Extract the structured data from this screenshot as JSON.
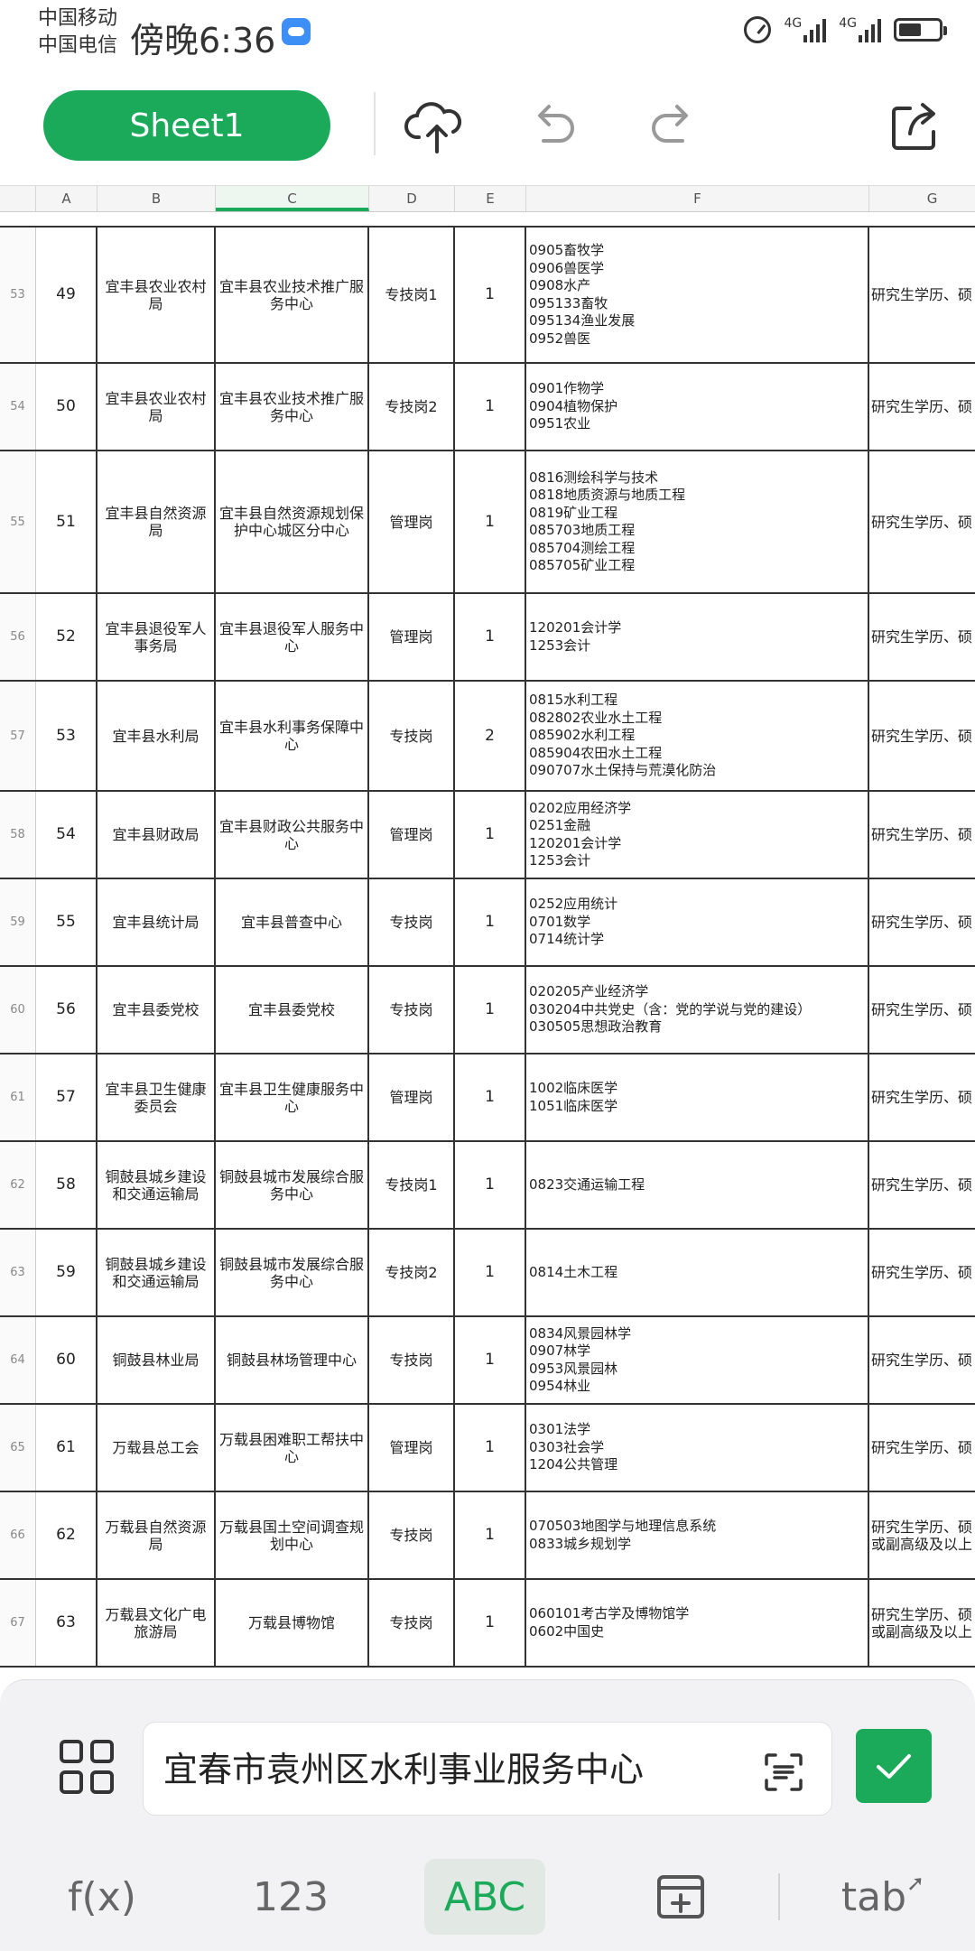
{
  "status": {
    "carrier1": "中国移动",
    "carrier2": "中国电信",
    "time": "傍晚6:36",
    "net1": "4G",
    "net2": "4G"
  },
  "toolbar": {
    "sheet_label": "Sheet1",
    "icons": [
      "cloud-upload-icon",
      "undo-icon",
      "redo-icon",
      "share-icon"
    ]
  },
  "columns": [
    "A",
    "B",
    "C",
    "D",
    "E",
    "F",
    "G"
  ],
  "rows": [
    {
      "rn": "53",
      "a": "49",
      "b": "宜丰县农业农村局",
      "c": "宜丰县农业技术推广服务中心",
      "d": "专技岗1",
      "e": "1",
      "f": "0905畜牧学\n0906兽医学\n0908水产\n095133畜牧\n095134渔业发展\n0952兽医",
      "g": "研究生学历、硕"
    },
    {
      "rn": "54",
      "a": "50",
      "b": "宜丰县农业农村局",
      "c": "宜丰县农业技术推广服务中心",
      "d": "专技岗2",
      "e": "1",
      "f": "0901作物学\n0904植物保护\n0951农业",
      "g": "研究生学历、硕"
    },
    {
      "rn": "55",
      "a": "51",
      "b": "宜丰县自然资源局",
      "c": "宜丰县自然资源规划保护中心城区分中心",
      "d": "管理岗",
      "e": "1",
      "f": "0816测绘科学与技术\n0818地质资源与地质工程\n0819矿业工程\n085703地质工程\n085704测绘工程\n085705矿业工程",
      "g": "研究生学历、硕"
    },
    {
      "rn": "56",
      "a": "52",
      "b": "宜丰县退役军人事务局",
      "c": "宜丰县退役军人服务中心",
      "d": "管理岗",
      "e": "1",
      "f": "120201会计学\n1253会计",
      "g": "研究生学历、硕"
    },
    {
      "rn": "57",
      "a": "53",
      "b": "宜丰县水利局",
      "c": "宜丰县水利事务保障中心",
      "d": "专技岗",
      "e": "2",
      "f": "0815水利工程\n082802农业水土工程\n085902水利工程\n085904农田水土工程\n090707水土保持与荒漠化防治",
      "g": "研究生学历、硕"
    },
    {
      "rn": "58",
      "a": "54",
      "b": "宜丰县财政局",
      "c": "宜丰县财政公共服务中心",
      "d": "管理岗",
      "e": "1",
      "f": "0202应用经济学\n0251金融\n120201会计学\n1253会计",
      "g": "研究生学历、硕"
    },
    {
      "rn": "59",
      "a": "55",
      "b": "宜丰县统计局",
      "c": "宜丰县普查中心",
      "d": "专技岗",
      "e": "1",
      "f": "0252应用统计\n0701数学\n0714统计学",
      "g": "研究生学历、硕"
    },
    {
      "rn": "60",
      "a": "56",
      "b": "宜丰县委党校",
      "c": "宜丰县委党校",
      "d": "专技岗",
      "e": "1",
      "f": "020205产业经济学\n030204中共党史（含：党的学说与党的建设）\n030505思想政治教育",
      "g": "研究生学历、硕"
    },
    {
      "rn": "61",
      "a": "57",
      "b": "宜丰县卫生健康委员会",
      "c": "宜丰县卫生健康服务中心",
      "d": "管理岗",
      "e": "1",
      "f": "1002临床医学\n1051临床医学",
      "g": "研究生学历、硕"
    },
    {
      "rn": "62",
      "a": "58",
      "b": "铜鼓县城乡建设和交通运输局",
      "c": "铜鼓县城市发展综合服务中心",
      "d": "专技岗1",
      "e": "1",
      "f": "0823交通运输工程",
      "g": "研究生学历、硕"
    },
    {
      "rn": "63",
      "a": "59",
      "b": "铜鼓县城乡建设和交通运输局",
      "c": "铜鼓县城市发展综合服务中心",
      "d": "专技岗2",
      "e": "1",
      "f": "0814土木工程",
      "g": "研究生学历、硕"
    },
    {
      "rn": "64",
      "a": "60",
      "b": "铜鼓县林业局",
      "c": "铜鼓县林场管理中心",
      "d": "专技岗",
      "e": "1",
      "f": "0834风景园林学\n0907林学\n0953风景园林\n0954林业",
      "g": "研究生学历、硕"
    },
    {
      "rn": "65",
      "a": "61",
      "b": "万载县总工会",
      "c": "万载县困难职工帮扶中心",
      "d": "管理岗",
      "e": "1",
      "f": "0301法学\n0303社会学\n1204公共管理",
      "g": "研究生学历、硕"
    },
    {
      "rn": "66",
      "a": "62",
      "b": "万载县自然资源局",
      "c": "万载县国土空间调查规划中心",
      "d": "专技岗",
      "e": "1",
      "f": "070503地图学与地理信息系统\n0833城乡规划学",
      "g": "研究生学历、硕\n或副高级及以上"
    },
    {
      "rn": "67",
      "a": "63",
      "b": "万载县文化广电旅游局",
      "c": "万载县博物馆",
      "d": "专技岗",
      "e": "1",
      "f": "060101考古学及博物馆学\n0602中国史",
      "g": "研究生学历、硕\n或副高级及以上"
    }
  ],
  "formula_bar": {
    "value": "宜春市袁州区水利事业服务中心"
  },
  "keyboard_tabs": {
    "fx": "f(x)",
    "num": "123",
    "abc": "ABC",
    "tab": "tab"
  }
}
